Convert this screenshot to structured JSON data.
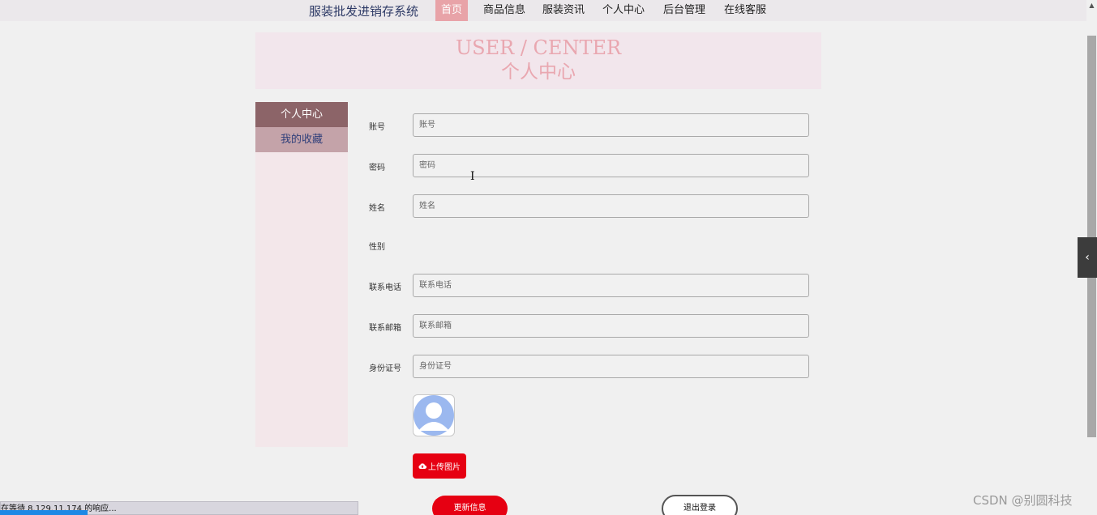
{
  "nav": {
    "brand": "服装批发进销存系统",
    "items": [
      "首页",
      "商品信息",
      "服装资讯",
      "个人中心",
      "后台管理",
      "在线客服"
    ]
  },
  "banner": {
    "title_en": "USER / CENTER",
    "title_cn": "个人中心"
  },
  "sidebar": {
    "items": [
      "个人中心",
      "我的收藏"
    ]
  },
  "form": {
    "account_label": "账号",
    "account_placeholder": "账号",
    "password_label": "密码",
    "password_placeholder": "密码",
    "name_label": "姓名",
    "name_placeholder": "姓名",
    "gender_label": "性别",
    "phone_label": "联系电话",
    "phone_placeholder": "联系电话",
    "email_label": "联系邮箱",
    "email_placeholder": "联系邮箱",
    "idcard_label": "身份证号",
    "idcard_placeholder": "身份证号",
    "upload_label": "上传图片",
    "update_label": "更新信息",
    "logout_label": "退出登录"
  },
  "status": {
    "text": "在等待 8.129.11.174 的响应..."
  },
  "watermark": "CSDN @别圆科技",
  "colors": {
    "accent_red": "#e60012",
    "nav_active": "#e8a3a8",
    "sidebar_active": "#8c6468",
    "banner_text": "#e9a7b0"
  }
}
